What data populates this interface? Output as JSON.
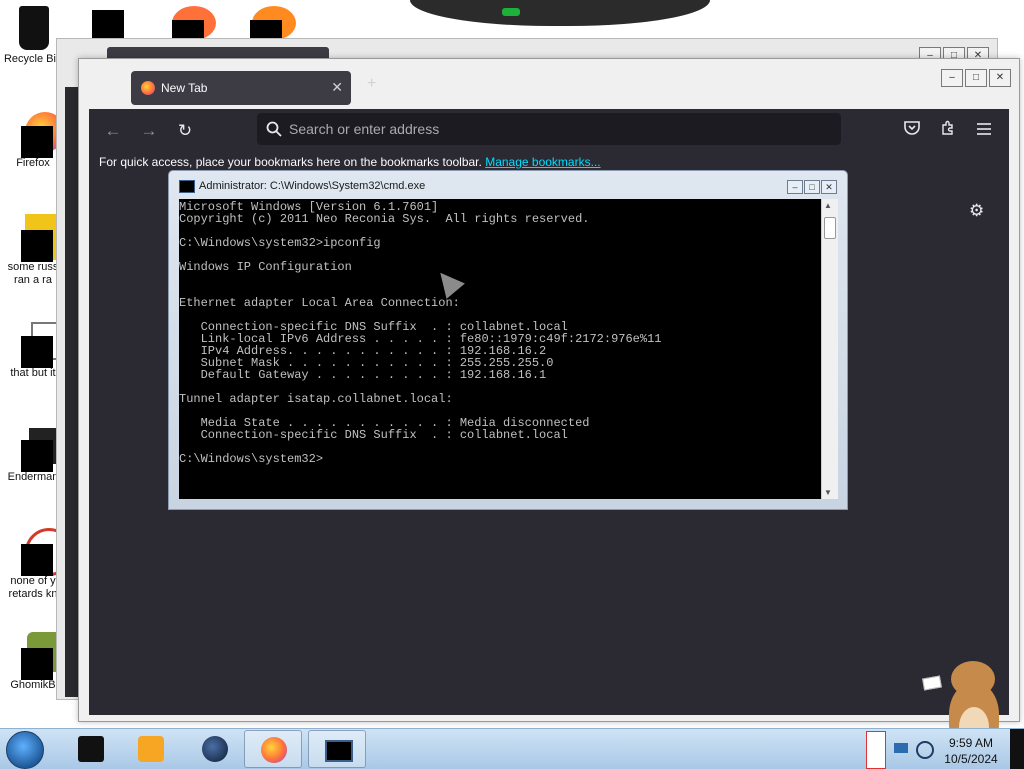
{
  "desktop": {
    "icons": [
      {
        "label": "Recycle Bin",
        "name": "recycle-bin"
      },
      {
        "label": "Firefox",
        "name": "firefox"
      },
      {
        "label": "some russ\nran a ra",
        "name": "some-russ"
      },
      {
        "label": "that but it",
        "name": "that-but-it"
      },
      {
        "label": "Enderman",
        "name": "enderman"
      },
      {
        "label": "none of y\nretards kn",
        "name": "none-of-y"
      },
      {
        "label": "GhomikB",
        "name": "ghomikb"
      }
    ]
  },
  "browser": {
    "tab": {
      "title": "New Tab",
      "close_glyph": "✕"
    },
    "new_tab_glyph": "+",
    "nav": {
      "back": "←",
      "forward": "→",
      "reload": "↻"
    },
    "search_icon": "magnifier-icon",
    "url_placeholder": "Search or enter address",
    "bookmarks": {
      "prompt": "For quick access, place your bookmarks here on the bookmarks toolbar.",
      "link": "Manage bookmarks..."
    },
    "toolbar_icons": [
      "pocket-icon",
      "extensions-icon",
      "menu-icon"
    ],
    "gear_glyph": "⚙"
  },
  "cmd": {
    "title": "Administrator: C:\\Windows\\System32\\cmd.exe",
    "lines": [
      "Microsoft Windows [Version 6.1.7601]",
      "Copyright (c) 2011 Neo Reconia Sys.  All rights reserved.",
      "",
      "C:\\Windows\\system32>ipconfig",
      "",
      "Windows IP Configuration",
      "",
      "",
      "Ethernet adapter Local Area Connection:",
      "",
      "   Connection-specific DNS Suffix  . : collabnet.local",
      "   Link-local IPv6 Address . . . . . : fe80::1979:c49f:2172:976e%11",
      "   IPv4 Address. . . . . . . . . . . : 192.168.16.2",
      "   Subnet Mask . . . . . . . . . . . : 255.255.255.0",
      "   Default Gateway . . . . . . . . . : 192.168.16.1",
      "",
      "Tunnel adapter isatap.collabnet.local:",
      "",
      "   Media State . . . . . . . . . . . : Media disconnected",
      "   Connection-specific DNS Suffix  . : collabnet.local",
      "",
      "C:\\Windows\\system32>"
    ]
  },
  "taskbar": {
    "items": [
      "start-button",
      "app-1",
      "media-player",
      "globe",
      "firefox",
      "cmd"
    ],
    "clock": {
      "time": "9:59 AM",
      "date": "10/5/2024"
    }
  },
  "colors": {
    "browser_bg": "#2b2a33",
    "url_bg": "#1c1b22",
    "link": "#00ddff",
    "console_bg": "#000000",
    "console_fg": "#c0c0c0"
  }
}
